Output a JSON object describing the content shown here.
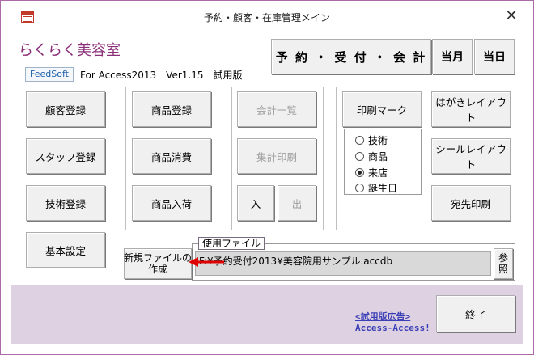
{
  "window": {
    "title": "予約・顧客・在庫管理メイン",
    "close_glyph": "✕"
  },
  "brand": {
    "name": "らくらく美容室",
    "feedsoft": "FeedSoft",
    "version": "For Access2013　Ver1.15　試用版"
  },
  "top_buttons": {
    "reservation": "予 約 ・ 受 付 ・ 会 計",
    "this_month": "当月",
    "today": "当日"
  },
  "left_buttons": {
    "customer": "顧客登録",
    "staff": "スタッフ登録",
    "technique": "技術登録",
    "settings": "基本設定"
  },
  "product_buttons": {
    "register": "商品登録",
    "consume": "商品消費",
    "arrival": "商品入荷"
  },
  "accounting_buttons": {
    "list": "会計一覧",
    "summary_print": "集計印刷",
    "in": "入",
    "out": "出"
  },
  "print_group": {
    "print_mark": "印刷マーク",
    "postcard_layout": "はがきレイアウト",
    "seal_layout": "シールレイアウト",
    "address_print": "宛先印刷",
    "options": [
      {
        "label": "技術",
        "selected": false
      },
      {
        "label": "商品",
        "selected": false
      },
      {
        "label": "来店",
        "selected": true
      },
      {
        "label": "誕生日",
        "selected": false
      }
    ]
  },
  "file_section": {
    "new_file_button": "新規ファイルの\n作成",
    "label": "使用ファイル",
    "path": "F:¥予約受付2013¥美容院用サンプル.accdb",
    "browse": "参\n照"
  },
  "footer": {
    "ad_link": "<試用版広告>",
    "access_link": "Access-Access!",
    "exit": "終了"
  },
  "colors": {
    "brand": "#8b2f7a",
    "footer_bg": "#ddd1e2",
    "window_border": "#a96aa7",
    "link": "#3b3fb5",
    "arrow": "#e00000"
  }
}
